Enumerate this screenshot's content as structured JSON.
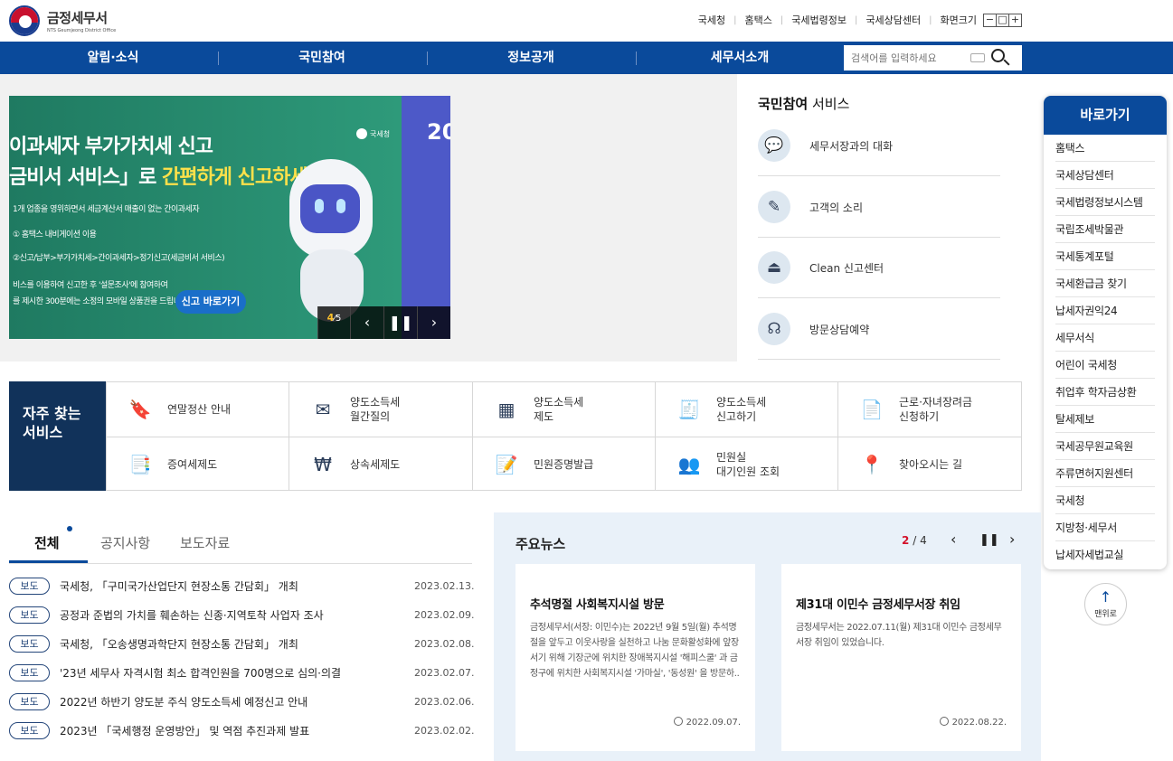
{
  "header": {
    "logo_title": "금정세무서",
    "logo_sub": "NTS Geumjeong District Office",
    "utils": [
      "국세청",
      "홈택스",
      "국세법령정보",
      "국세상담센터"
    ],
    "zoom_label": "화면크기",
    "zoom_buttons": [
      "−",
      "□",
      "+"
    ]
  },
  "nav": {
    "items": [
      "알림·소식",
      "국민참여",
      "정보공개",
      "세무서소개"
    ],
    "search_placeholder": "검색어를 입력하세요"
  },
  "banner": {
    "line1": "이과세자 부가가치세 신고",
    "line2_a": "금비서 서비스」로 ",
    "line2_b": "간편하게 신고하세요.",
    "note1": "1개 업종을 영위하면서 세금계산서 매출이 없는 간이과세자",
    "note2": "① 홈택스 내비게이션 이용",
    "note3": "②신고/납부>부가가치세>간이과세자>정기신고(세금비서 서비스)",
    "note4": "비스를 이용하여 신고한 후 '설문조사'에 참여하여",
    "note5": "를 제시한 300분에는 소정의 모바일 상품권을 드립니다.",
    "cta": "신고 바로가기",
    "badge": "국세청",
    "right_text": "20",
    "counter_current": "4",
    "counter_total": "5"
  },
  "participation": {
    "title_bold": "국민참여",
    "title_rest": " 서비스",
    "items": [
      {
        "label": "세무서장과의 대화",
        "icon": "chat-bubble-icon"
      },
      {
        "label": "고객의 소리",
        "icon": "pencil-icon"
      },
      {
        "label": "Clean 신고센터",
        "icon": "siren-icon"
      },
      {
        "label": "방문상담예약",
        "icon": "headset-icon"
      }
    ]
  },
  "quick_links": {
    "title": "바로가기",
    "items": [
      "홈택스",
      "국세상담센터",
      "국세법령정보시스템",
      "국립조세박물관",
      "국세통계포털",
      "국세환급금 찾기",
      "납세자권익24",
      "세무서식",
      "어린이 국세청",
      "취업후 학자금상환",
      "탈세제보",
      "국세공무원교육원",
      "주류면허지원센터",
      "국세청",
      "지방청·세무서",
      "납세자세법교실"
    ],
    "top_label": "맨위로"
  },
  "frequent": {
    "title": "자주 찾는\n서비스",
    "items": [
      {
        "label": "연말정산 안내",
        "icon": "bookmark-icon"
      },
      {
        "label": "양도소득세\n월간질의",
        "icon": "consult-icon"
      },
      {
        "label": "양도소득세\n제도",
        "icon": "calculator-icon"
      },
      {
        "label": "양도소득세\n신고하기",
        "icon": "receipt-icon"
      },
      {
        "label": "근로·자녀장려금\n신청하기",
        "icon": "document-icon"
      },
      {
        "label": "증여세제도",
        "icon": "documents-icon"
      },
      {
        "label": "상속세제도",
        "icon": "hand-coin-icon"
      },
      {
        "label": "민원증명발급",
        "icon": "certificate-icon"
      },
      {
        "label": "민원실\n대기인원 조회",
        "icon": "people-icon"
      },
      {
        "label": "찾아오시는 길",
        "icon": "location-pin-icon"
      }
    ]
  },
  "news_tabs": {
    "tabs": [
      "전체",
      "공지사항",
      "보도자료"
    ],
    "rows": [
      {
        "badge": "보도",
        "title": "국세청, 「구미국가산업단지 현장소통 간담회」 개최",
        "date": "2023.02.13."
      },
      {
        "badge": "보도",
        "title": "공정과 준법의 가치를 훼손하는 신종·지역토착 사업자 조사",
        "date": "2023.02.09."
      },
      {
        "badge": "보도",
        "title": "국세청, 「오송생명과학단지 현장소통 간담회」 개최",
        "date": "2023.02.08."
      },
      {
        "badge": "보도",
        "title": "'23년 세무사 자격시험 최소 합격인원을 700명으로 심의·의결",
        "date": "2023.02.07."
      },
      {
        "badge": "보도",
        "title": "2022년 하반기 양도분 주식 양도소득세 예정신고 안내",
        "date": "2023.02.06."
      },
      {
        "badge": "보도",
        "title": "2023년 「국세행정 운영방안」 및 역점 추진과제 발표",
        "date": "2023.02.02."
      }
    ]
  },
  "main_news": {
    "title": "주요뉴스",
    "page_current": "2",
    "page_sep": "/",
    "page_total": "4",
    "cards": [
      {
        "title": "추석명절 사회복지시설 방문",
        "desc": "금정세무서(서장: 이민수)는 2022년 9월 5일(월) 추석명절을 앞두고 이웃사랑을 실천하고 나눔 문화활성화에 앞장서기 위해 기장군에 위치한 장애복지시설 '해피스쿨' 과 금정구에 위치한 사회복지시설 '가마실', '동성원' 을 방문하..",
        "date": "2022.09.07."
      },
      {
        "title": "제31대 이민수 금정세무서장 취임",
        "desc": "금정세무서는 2022.07.11(월) 제31대 이민수 금정세무서장 취임이 있었습니다.",
        "date": "2022.08.22."
      }
    ]
  }
}
